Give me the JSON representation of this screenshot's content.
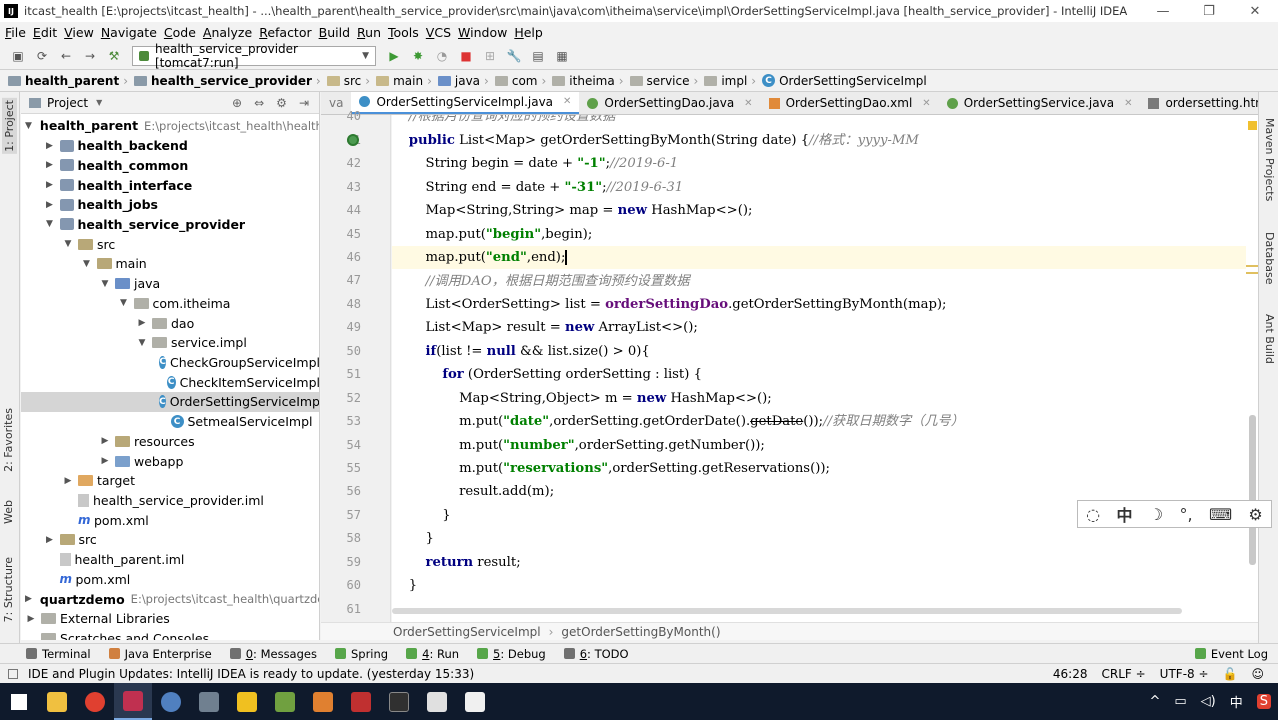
{
  "window": {
    "title": "itcast_health [E:\\projects\\itcast_health] - ...\\health_parent\\health_service_provider\\src\\main\\java\\com\\itheima\\service\\impl\\OrderSettingServiceImpl.java [health_service_provider] - IntelliJ IDEA",
    "minimize": "—",
    "maximize": "❐",
    "close": "✕"
  },
  "menu": [
    "File",
    "Edit",
    "View",
    "Navigate",
    "Code",
    "Analyze",
    "Refactor",
    "Build",
    "Run",
    "Tools",
    "VCS",
    "Window",
    "Help"
  ],
  "toolbar": {
    "run_config": "health_service_provider [tomcat7:run]",
    "run_config_arrow": "▼",
    "icons": [
      "save-icon",
      "refresh-icon",
      "back-icon",
      "forward-icon",
      "build-icon",
      "run-icon",
      "debug-icon",
      "coverage-icon",
      "stop-icon",
      "settings-icon",
      "structure-icon",
      "sdk-icon"
    ]
  },
  "navbar": [
    {
      "label": "health_parent",
      "bold": true
    },
    {
      "label": "health_service_provider",
      "bold": true
    },
    {
      "label": "src"
    },
    {
      "label": "main"
    },
    {
      "label": "java"
    },
    {
      "label": "com"
    },
    {
      "label": "itheima"
    },
    {
      "label": "service"
    },
    {
      "label": "impl"
    },
    {
      "label": "OrderSettingServiceImpl"
    }
  ],
  "left_strip": {
    "project": "1: Project",
    "favorites": "2: Favorites",
    "web": "Web",
    "structure": "7: Structure"
  },
  "right_strip": {
    "maven": "Maven Projects",
    "database": "Database",
    "ant": "Ant Build"
  },
  "project_panel": {
    "title": "Project",
    "title_arrow": "▼",
    "tree": [
      {
        "label": "health_parent",
        "path": "E:\\projects\\itcast_health\\health_p",
        "bold": true,
        "indent": 0,
        "arrow": "▼",
        "icon": "module"
      },
      {
        "label": "health_backend",
        "bold": true,
        "indent": 1,
        "arrow": "▶",
        "icon": "module"
      },
      {
        "label": "health_common",
        "bold": true,
        "indent": 1,
        "arrow": "▶",
        "icon": "module"
      },
      {
        "label": "health_interface",
        "bold": true,
        "indent": 1,
        "arrow": "▶",
        "icon": "module"
      },
      {
        "label": "health_jobs",
        "bold": true,
        "indent": 1,
        "arrow": "▶",
        "icon": "module"
      },
      {
        "label": "health_service_provider",
        "bold": true,
        "indent": 1,
        "arrow": "▼",
        "icon": "module"
      },
      {
        "label": "src",
        "indent": 2,
        "arrow": "▼",
        "icon": "folder"
      },
      {
        "label": "main",
        "indent": 3,
        "arrow": "▼",
        "icon": "folder"
      },
      {
        "label": "java",
        "indent": 4,
        "arrow": "▼",
        "icon": "src"
      },
      {
        "label": "com.itheima",
        "indent": 5,
        "arrow": "▼",
        "icon": "pkg"
      },
      {
        "label": "dao",
        "indent": 6,
        "arrow": "▶",
        "icon": "pkg"
      },
      {
        "label": "service.impl",
        "indent": 6,
        "arrow": "▼",
        "icon": "pkg"
      },
      {
        "label": "CheckGroupServiceImpl",
        "indent": 7,
        "arrow": "",
        "icon": "class"
      },
      {
        "label": "CheckItemServiceImpl",
        "indent": 7,
        "arrow": "",
        "icon": "class"
      },
      {
        "label": "OrderSettingServiceImp",
        "indent": 7,
        "arrow": "",
        "icon": "class",
        "selected": true
      },
      {
        "label": "SetmealServiceImpl",
        "indent": 7,
        "arrow": "",
        "icon": "class"
      },
      {
        "label": "resources",
        "indent": 4,
        "arrow": "▶",
        "icon": "folder"
      },
      {
        "label": "webapp",
        "indent": 4,
        "arrow": "▶",
        "icon": "blue"
      },
      {
        "label": "target",
        "indent": 2,
        "arrow": "▶",
        "icon": "org"
      },
      {
        "label": "health_service_provider.iml",
        "indent": 2,
        "arrow": "",
        "icon": "file"
      },
      {
        "label": "pom.xml",
        "indent": 2,
        "arrow": "",
        "icon": "m"
      },
      {
        "label": "src",
        "indent": 1,
        "arrow": "▶",
        "icon": "folder"
      },
      {
        "label": "health_parent.iml",
        "indent": 1,
        "arrow": "",
        "icon": "file"
      },
      {
        "label": "pom.xml",
        "indent": 1,
        "arrow": "",
        "icon": "m"
      },
      {
        "label": "quartzdemo",
        "path": "E:\\projects\\itcast_health\\quartzder",
        "bold": true,
        "indent": 0,
        "arrow": "▶",
        "icon": "module"
      },
      {
        "label": "External Libraries",
        "indent": 0,
        "arrow": "▶",
        "icon": "lib"
      },
      {
        "label": "Scratches and Consoles",
        "indent": 0,
        "arrow": "",
        "icon": "lib"
      }
    ]
  },
  "editor_tabs": [
    {
      "label": "va",
      "icon": "none"
    },
    {
      "label": "OrderSettingServiceImpl.java",
      "icon": "class",
      "active": true
    },
    {
      "label": "OrderSettingDao.java",
      "icon": "interface"
    },
    {
      "label": "OrderSettingDao.xml",
      "icon": "xml"
    },
    {
      "label": "OrderSettingService.java",
      "icon": "interface"
    },
    {
      "label": "ordersetting.html",
      "icon": "html"
    },
    {
      "label": "≡",
      "icon": "none"
    }
  ],
  "gutter_lines": [
    "40",
    "41",
    "42",
    "43",
    "44",
    "45",
    "46",
    "47",
    "48",
    "49",
    "50",
    "51",
    "52",
    "53",
    "54",
    "55",
    "56",
    "57",
    "58",
    "59",
    "60",
    "61"
  ],
  "code": {
    "l40": "    //根据月份查询对应的预约设置数据",
    "l41_kw": "public",
    "l41_a": " List<Map> getOrderSettingByMonth(String date) {",
    "l41_cm": "//格式：yyyy-MM",
    "l42_a": "        String begin = date + ",
    "l42_str": "\"-1\"",
    "l42_b": ";",
    "l42_cm": "//2019-6-1",
    "l43_a": "        String end = date + ",
    "l43_str": "\"-31\"",
    "l43_b": ";",
    "l43_cm": "//2019-6-31",
    "l44_a": "        Map<String,String> map = ",
    "l44_kw": "new",
    "l44_b": " HashMap<>();",
    "l45_a": "        map.put(",
    "l45_str": "\"begin\"",
    "l45_b": ",begin);",
    "l46_a": "        map.put(",
    "l46_str": "\"end\"",
    "l46_b": ",end);",
    "l47_cm": "        //调用DAO，根据日期范围查询预约设置数据",
    "l48_a": "        List<OrderSetting> list = ",
    "l48_fld": "orderSettingDao",
    "l48_b": ".getOrderSettingByMonth(map);",
    "l49_a": "        List<Map> result = ",
    "l49_kw": "new",
    "l49_b": " ArrayList<>();",
    "l50_kw": "if",
    "l50_a": "(list != ",
    "l50_kw2": "null",
    "l50_b": " && list.size() > 0){",
    "l51_kw": "for",
    "l51_a": " (OrderSetting orderSetting : list) {",
    "l52_a": "                Map<String,Object> m = ",
    "l52_kw": "new",
    "l52_b": " HashMap<>();",
    "l53_a": "                m.put(",
    "l53_str": "\"date\"",
    "l53_b": ",orderSetting.getOrderDate().",
    "l53_strike": "getDate",
    "l53_c": "());",
    "l53_cm": "//获取日期数字（几号）",
    "l54_a": "                m.put(",
    "l54_str": "\"number\"",
    "l54_b": ",orderSetting.getNumber());",
    "l55_a": "                m.put(",
    "l55_str": "\"reservations\"",
    "l55_b": ",orderSetting.getReservations());",
    "l56": "                result.add(m);",
    "l57": "            }",
    "l58": "        }",
    "l59_kw": "return",
    "l59_a": " result;",
    "l60": "    }",
    "l61": ""
  },
  "editor_breadcrumb": [
    "OrderSettingServiceImpl",
    "getOrderSettingByMonth()"
  ],
  "tool_windows": [
    {
      "label": "Terminal",
      "num": ""
    },
    {
      "label": "Java Enterprise",
      "num": ""
    },
    {
      "label": "Messages",
      "num": "0"
    },
    {
      "label": "Spring",
      "num": ""
    },
    {
      "label": "Run",
      "num": "4"
    },
    {
      "label": "Debug",
      "num": "5"
    },
    {
      "label": "TODO",
      "num": "6"
    }
  ],
  "event_log": "Event Log",
  "status": {
    "message": "IDE and Plugin Updates: IntelliJ IDEA is ready to update. (yesterday 15:33)",
    "position": "46:28",
    "line_sep": "CRLF ÷",
    "encoding": "UTF-8 ÷"
  },
  "ime": {
    "chinese": "中",
    "moon": "☽",
    "punct": "°,",
    "keyboard": "⌨",
    "gear": "⚙",
    "logo": "◌"
  },
  "taskbar": {
    "tray_up": "^",
    "tray_lang": "中",
    "tray_end": "S"
  }
}
